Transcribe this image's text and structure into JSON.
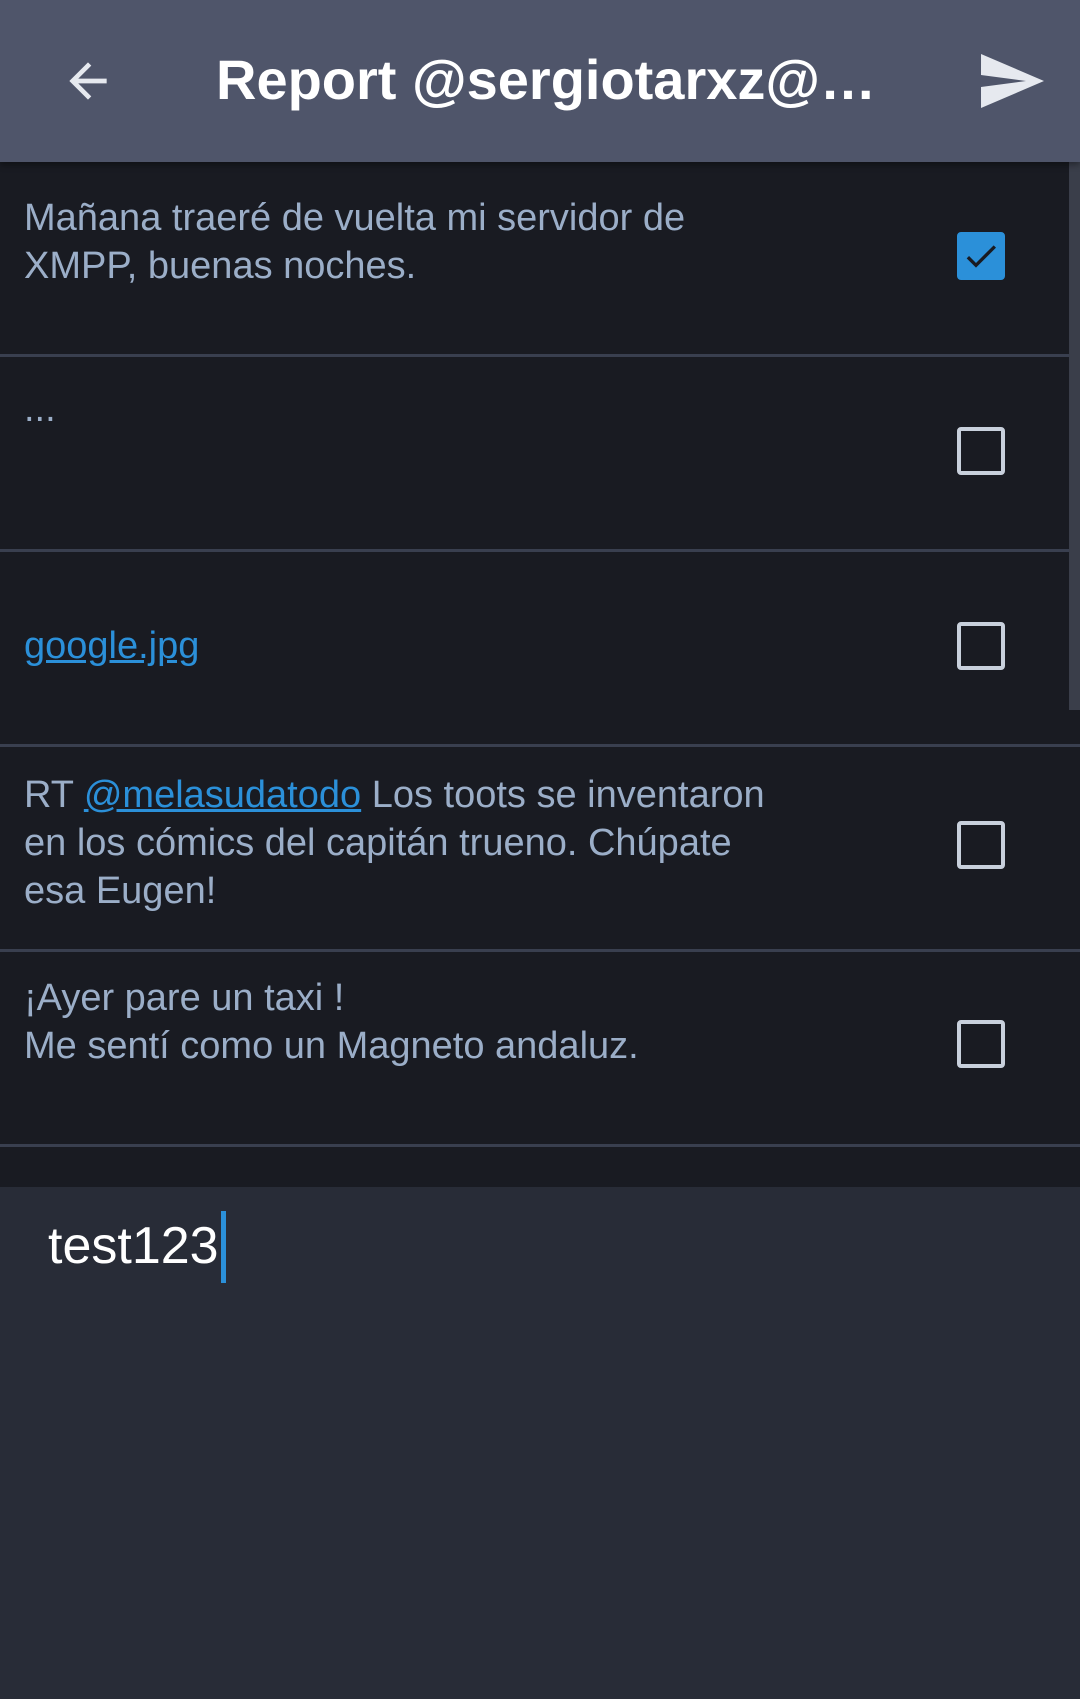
{
  "toolbar": {
    "title": "Report @sergiotarxz@m…",
    "back_icon": "arrow-left-icon",
    "send_icon": "send-icon"
  },
  "statuses": [
    {
      "line1": "Mañana traeré de vuelta mi servidor de",
      "line2": "XMPP, buenas noches.",
      "checked": true
    },
    {
      "text": "...",
      "checked": false
    },
    {
      "link": "google.jpg",
      "checked": false
    },
    {
      "prefix": "RT ",
      "mention": "@melasudatodo",
      "suffix": " Los toots se inventaron",
      "line2": "en los cómics del capitán trueno. Chúpate",
      "line3": "esa Eugen!",
      "checked": false
    },
    {
      "line1": "¡Ayer pare un taxi !",
      "line2": "Me sentí como un Magneto andaluz.",
      "checked": false
    }
  ],
  "comment": {
    "value": "test123"
  },
  "colors": {
    "toolbar": "#4f556a",
    "list_bg": "#191b22",
    "accent": "#2b90d9",
    "text": "#9baec8"
  }
}
